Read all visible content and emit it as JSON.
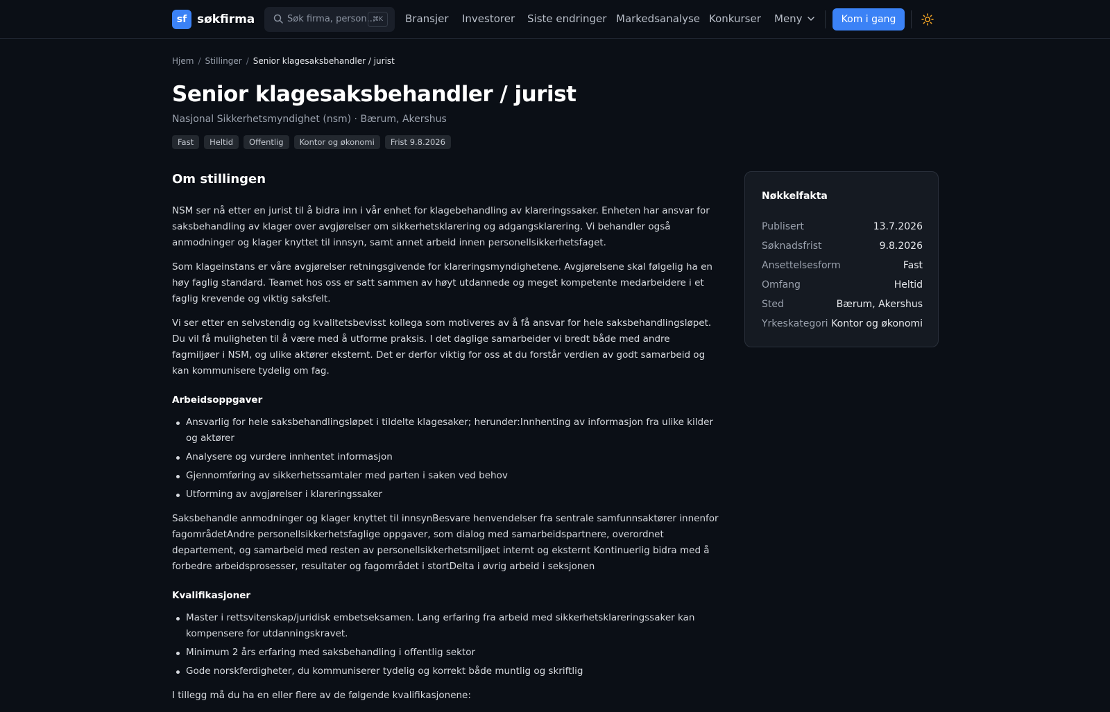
{
  "header": {
    "logo_badge": "sf",
    "logo_text": "søkfirma",
    "search_placeholder": "Søk firma, person...",
    "search_shortcut": "⌘K",
    "nav": [
      "Bransjer",
      "Investorer",
      "Siste endringer",
      "Markedsanalyse",
      "Konkurser"
    ],
    "menu_label": "Meny",
    "cta_label": "Kom i gang",
    "accent_color": "#3b82f6"
  },
  "breadcrumb": {
    "home": "Hjem",
    "section": "Stillinger",
    "current": "Senior klagesaksbehandler / jurist"
  },
  "job": {
    "title": "Senior klagesaksbehandler / jurist",
    "subtitle": "Nasjonal Sikkerhetsmyndighet (nsm) · Bærum, Akershus",
    "tags": [
      "Fast",
      "Heltid",
      "Offentlig",
      "Kontor og økonomi",
      "Frist 9.8.2026"
    ]
  },
  "content": {
    "section_title": "Om stillingen",
    "intro": [
      "NSM ser nå etter en jurist til å bidra inn i vår enhet for klagebehandling av klareringssaker. Enheten har ansvar for saksbehandling av klager over avgjørelser om sikkerhetsklarering og adgangsklarering. Vi behandler også anmodninger og klager knyttet til innsyn, samt annet arbeid innen personellsikkerhetsfaget.",
      "Som klageinstans er våre avgjørelser retningsgivende for klareringsmyndighetene. Avgjørelsene skal følgelig ha en høy faglig standard. Teamet hos oss er satt sammen av høyt utdannede og meget kompetente medarbeidere i et faglig krevende og viktig saksfelt.",
      "Vi ser etter en selvstendig og kvalitetsbevisst kollega som motiveres av å få ansvar for hele saksbehandlingsløpet. Du vil få muligheten til å være med å utforme praksis. I det daglige samarbeider vi bredt både med andre fagmiljøer i NSM, og ulike aktører eksternt. Det er derfor viktig for oss at du forstår verdien av godt samarbeid og kan kommunisere tydelig om fag."
    ],
    "tasks_heading": "Arbeidsoppgaver",
    "tasks": [
      "Ansvarlig for hele saksbehandlingsløpet i tildelte klagesaker; herunder:Innhenting av informasjon fra ulike kilder og aktører",
      "Analysere og vurdere innhentet informasjon",
      "Gjennomføring av sikkerhetssamtaler med parten i saken ved behov",
      "Utforming av avgjørelser i klareringssaker"
    ],
    "tasks_extra": "Saksbehandle anmodninger og klager knyttet til innsynBesvare henvendelser fra sentrale samfunnsaktører innenfor fagområdetAndre personellsikkerhetsfaglige oppgaver, som dialog med samarbeidspartnere, overordnet departement, og samarbeid med resten av personellsikkerhetsmiljøet internt og eksternt Kontinuerlig bidra med å forbedre arbeidsprosesser, resultater og fagområdet i stortDelta i øvrig arbeid i seksjonen",
    "quals_heading": "Kvalifikasjoner",
    "quals": [
      "Master i rettsvitenskap/juridisk embetseksamen. Lang erfaring fra arbeid med sikkerhetsklareringssaker kan kompensere for utdanningskravet.",
      "Minimum 2 års erfaring med saksbehandling i offentlig sektor",
      "Gode norskferdigheter, du kommuniserer tydelig og korrekt både muntlig og skriftlig"
    ],
    "quals_extra": "I tillegg må du ha en eller flere av de følgende kvalifikasjonene:"
  },
  "facts": {
    "title": "Nøkkelfakta",
    "rows": [
      {
        "label": "Publisert",
        "value": "13.7.2026"
      },
      {
        "label": "Søknadsfrist",
        "value": "9.8.2026"
      },
      {
        "label": "Ansettelsesform",
        "value": "Fast"
      },
      {
        "label": "Omfang",
        "value": "Heltid"
      },
      {
        "label": "Sted",
        "value": "Bærum, Akershus"
      },
      {
        "label": "Yrkeskategori",
        "value": "Kontor og økonomi"
      }
    ]
  }
}
